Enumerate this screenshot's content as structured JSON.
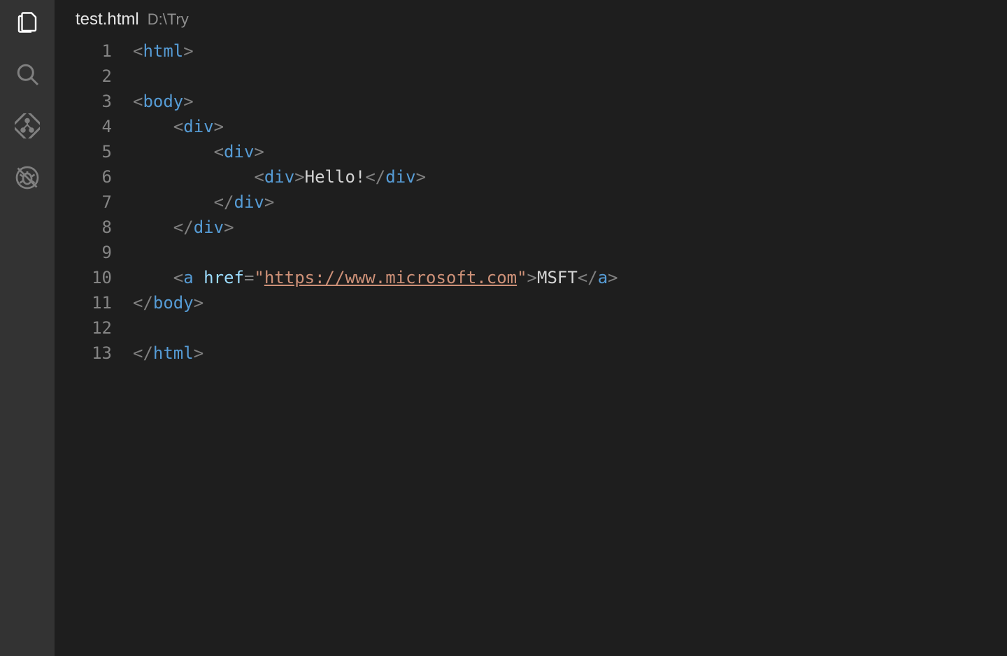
{
  "activityBar": {
    "items": [
      {
        "name": "explorer",
        "active": true
      },
      {
        "name": "search",
        "active": false
      },
      {
        "name": "scm",
        "active": false
      },
      {
        "name": "debug",
        "active": false
      }
    ]
  },
  "tab": {
    "filename": "test.html",
    "path": "D:\\Try"
  },
  "editor": {
    "lineNumbers": [
      "1",
      "2",
      "3",
      "4",
      "5",
      "6",
      "7",
      "8",
      "9",
      "10",
      "11",
      "12",
      "13"
    ],
    "lines": [
      [
        {
          "t": "p",
          "v": "<"
        },
        {
          "t": "tg",
          "v": "html"
        },
        {
          "t": "p",
          "v": ">"
        }
      ],
      [],
      [
        {
          "t": "p",
          "v": "<"
        },
        {
          "t": "tg",
          "v": "body"
        },
        {
          "t": "p",
          "v": ">"
        }
      ],
      [
        {
          "t": "p",
          "v": "    <"
        },
        {
          "t": "tg",
          "v": "div"
        },
        {
          "t": "p",
          "v": ">"
        }
      ],
      [
        {
          "t": "p",
          "v": "        <"
        },
        {
          "t": "tg",
          "v": "div"
        },
        {
          "t": "p",
          "v": ">"
        }
      ],
      [
        {
          "t": "p",
          "v": "            <"
        },
        {
          "t": "tg",
          "v": "div"
        },
        {
          "t": "p",
          "v": ">"
        },
        {
          "t": "tx",
          "v": "Hello!"
        },
        {
          "t": "p",
          "v": "</"
        },
        {
          "t": "tg",
          "v": "div"
        },
        {
          "t": "p",
          "v": ">"
        }
      ],
      [
        {
          "t": "p",
          "v": "        </"
        },
        {
          "t": "tg",
          "v": "div"
        },
        {
          "t": "p",
          "v": ">"
        }
      ],
      [
        {
          "t": "p",
          "v": "    </"
        },
        {
          "t": "tg",
          "v": "div"
        },
        {
          "t": "p",
          "v": ">"
        }
      ],
      [],
      [
        {
          "t": "p",
          "v": "    <"
        },
        {
          "t": "tg",
          "v": "a"
        },
        {
          "t": "tx",
          "v": " "
        },
        {
          "t": "at",
          "v": "href"
        },
        {
          "t": "p",
          "v": "="
        },
        {
          "t": "st",
          "v": "\""
        },
        {
          "t": "stu",
          "v": "https://www.microsoft.com"
        },
        {
          "t": "st",
          "v": "\""
        },
        {
          "t": "p",
          "v": ">"
        },
        {
          "t": "tx",
          "v": "MSFT"
        },
        {
          "t": "p",
          "v": "</"
        },
        {
          "t": "tg",
          "v": "a"
        },
        {
          "t": "p",
          "v": ">"
        }
      ],
      [
        {
          "t": "p",
          "v": "</"
        },
        {
          "t": "tg",
          "v": "body"
        },
        {
          "t": "p",
          "v": ">"
        }
      ],
      [],
      [
        {
          "t": "p",
          "v": "</"
        },
        {
          "t": "tg",
          "v": "html"
        },
        {
          "t": "p",
          "v": ">"
        }
      ]
    ]
  }
}
